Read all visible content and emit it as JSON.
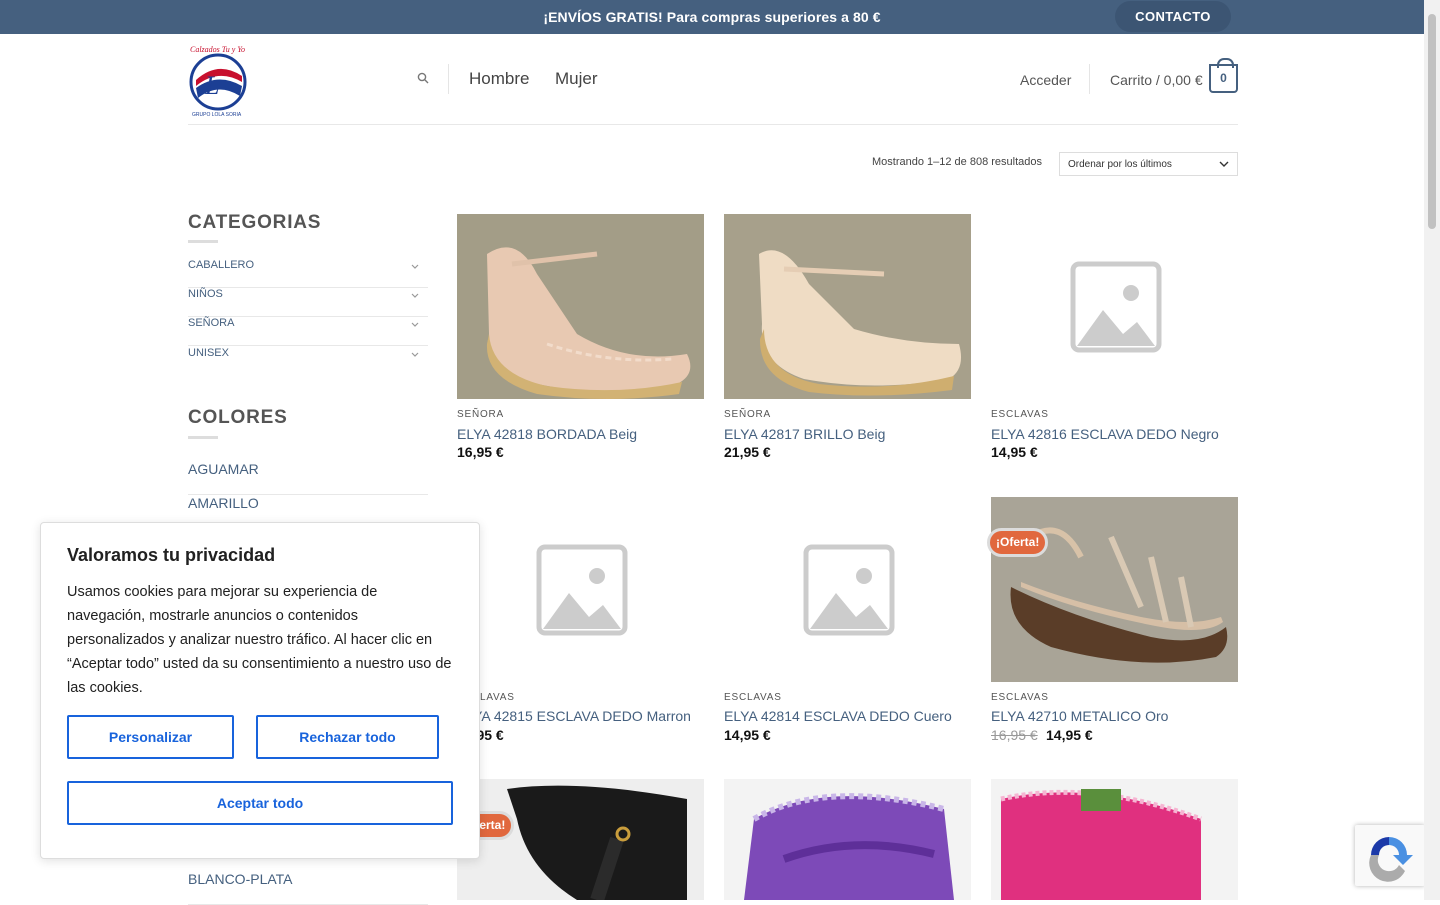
{
  "topbar": {
    "message": "¡ENVÍOS GRATIS! Para compras superiores a 80 €",
    "contact": "CONTACTO"
  },
  "header": {
    "logo_text_top": "Calzados Tu y Yo",
    "logo_text_bottom": "GRUPO LOLA SORIA",
    "nav": [
      "Hombre",
      "Mujer"
    ],
    "login": "Acceder",
    "cart": "Carrito / 0,00 €",
    "cart_count": "0"
  },
  "shop": {
    "results": "Mostrando 1–12 de 808 resultados",
    "orderby": "Ordenar por los últimos"
  },
  "sidebar": {
    "categories_title": "CATEGORIAS",
    "categories": [
      "CABALLERO",
      "NIÑOS",
      "SEÑORA",
      "UNISEX"
    ],
    "colors_title": "COLORES",
    "colors": [
      "AGUAMAR",
      "AMARILLO",
      "BLANCO-PLATA"
    ]
  },
  "products": [
    {
      "category": "SEÑORA",
      "title": "ELYA 42818 BORDADA Beig",
      "price": "16,95 €"
    },
    {
      "category": "SEÑORA",
      "title": "ELYA 42817 BRILLO Beig",
      "price": "21,95 €"
    },
    {
      "category": "ESCLAVAS",
      "title": "ELYA 42816 ESCLAVA DEDO Negro",
      "price": "14,95 €"
    },
    {
      "category": "ESCLAVAS",
      "title": "ELYA 42815 ESCLAVA DEDO Marron",
      "price": "14,95 €"
    },
    {
      "category": "ESCLAVAS",
      "title": "ELYA 42814 ESCLAVA DEDO Cuero",
      "price": "14,95 €"
    },
    {
      "category": "ESCLAVAS",
      "title": "ELYA 42710 METALICO Oro",
      "old_price": "16,95 €",
      "price": "14,95 €",
      "badge": "¡Oferta!"
    },
    {
      "badge": "¡Oferta!"
    }
  ],
  "cookie": {
    "title": "Valoramos tu privacidad",
    "text": "Usamos cookies para mejorar su experiencia de navegación, mostrarle anuncios o contenidos personalizados y analizar nuestro tráfico. Al hacer clic en “Aceptar todo” usted da su consentimiento a nuestro uso de las cookies.",
    "customize": "Personalizar",
    "reject": "Rechazar todo",
    "accept": "Aceptar todo"
  },
  "colors": {
    "brand": "#45607f",
    "sale": "#e1683e",
    "cookie_button": "#1863dc"
  }
}
